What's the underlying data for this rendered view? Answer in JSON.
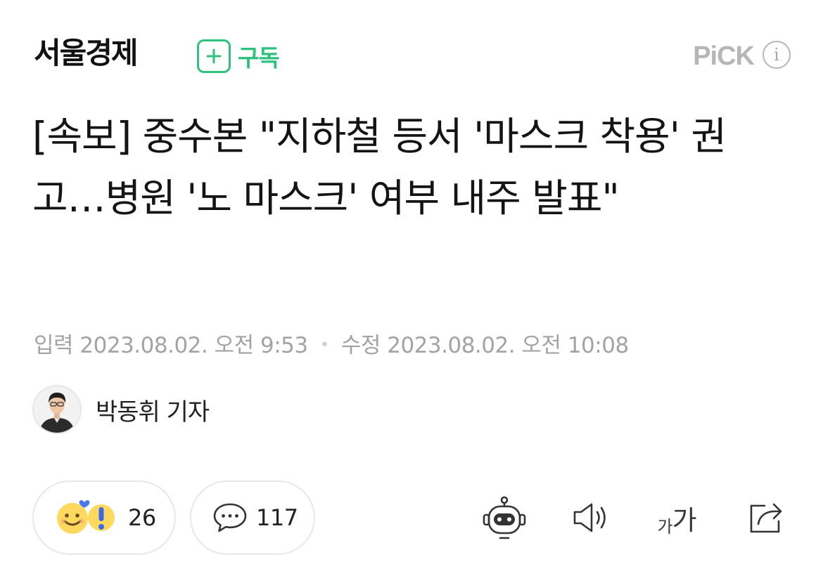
{
  "header": {
    "brand": "서울경제",
    "subscribe_label": "구독",
    "pick_label": "PiCK",
    "info_glyph": "i"
  },
  "article": {
    "title": "[속보] 중수본 \"지하철 등서 '마스크 착용' 권고…병원 '노 마스크' 여부 내주 발표\"",
    "input_label": "입력",
    "input_time": "2023.08.02. 오전 9:53",
    "separator": "•",
    "modified_label": "수정",
    "modified_time": "2023.08.02. 오전 10:08"
  },
  "author": {
    "name": "박동휘 기자"
  },
  "actions": {
    "reaction_count": "26",
    "comment_count": "117",
    "font_size_small": "가",
    "font_size_large": "가"
  },
  "icons": {
    "subscribe": "plus-icon",
    "info": "info-icon",
    "reaction": "reaction-emoji-icon",
    "comment": "speech-bubble-icon",
    "summary_bot": "robot-icon",
    "read_aloud": "speaker-icon",
    "font_size": "font-size-icon",
    "share": "share-icon"
  },
  "colors": {
    "accent_green": "#2ec27e",
    "meta_gray": "#a3a3a3",
    "pick_gray": "#b6b6b6"
  }
}
